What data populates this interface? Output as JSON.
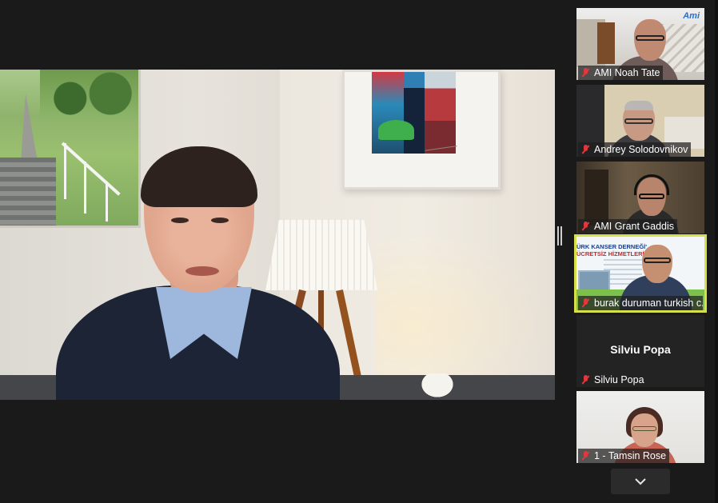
{
  "main_speaker": {
    "description_name": "active-speaker-video"
  },
  "participants": [
    {
      "label": "AMI Noah Tate",
      "muted": true,
      "badge": "Ami"
    },
    {
      "label": "Andrey Solodovnikov",
      "muted": true
    },
    {
      "label": "AMI Grant Gaddis",
      "muted": true
    },
    {
      "label": "burak duruman turkish c...",
      "muted": true,
      "active": true,
      "slide_title_line1": "ÜRK KANSER DERNEĞİ'",
      "slide_title_line2": "ÜCRETSİZ HİZMETLERİ"
    },
    {
      "label": "Silviu Popa",
      "muted": true,
      "display_name": "Silviu Popa",
      "video_off": true
    },
    {
      "label": "1 - Tamsin Rose",
      "muted": true
    }
  ],
  "controls": {
    "scroll_down_icon": "chevron-down-icon",
    "layout_handle_icon": "resize-handle-icon"
  },
  "colors": {
    "background": "#1a1a1a",
    "active_speaker_outline": "#d7e04a",
    "muted_icon": "#e0383e"
  }
}
